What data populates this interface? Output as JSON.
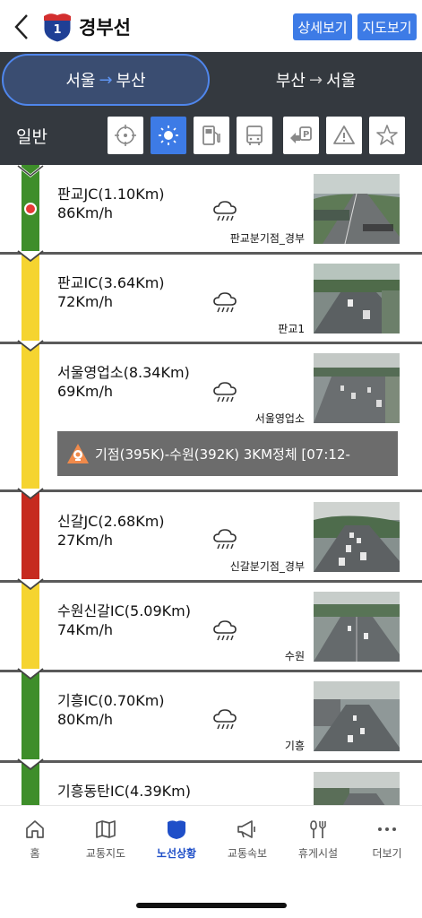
{
  "header": {
    "route_number": "1",
    "title": "경부선",
    "detail_button": "상세보기",
    "map_button": "지도보기"
  },
  "direction_tabs": [
    {
      "from": "서울",
      "arrow": "→",
      "to": "부산",
      "active": true
    },
    {
      "from": "부산",
      "arrow": "→",
      "to": "서울",
      "active": false
    }
  ],
  "filter": {
    "label": "일반",
    "buttons": [
      {
        "icon": "cctv-target-icon",
        "active": false
      },
      {
        "icon": "weather-sun-icon",
        "active": true
      },
      {
        "icon": "gas-station-icon",
        "active": false
      },
      {
        "icon": "bus-icon",
        "active": false
      },
      {
        "icon": "parking-exit-icon",
        "active": false
      },
      {
        "icon": "warning-icon",
        "active": false
      },
      {
        "icon": "favorite-star-icon",
        "active": false
      }
    ]
  },
  "colors": {
    "green": "#3e8e2a",
    "yellow": "#f5d430",
    "red": "#c62a1f",
    "accent": "#3d7be6",
    "dark_bg": "#34393f"
  },
  "segments": [
    {
      "name": "판교JC(1.10Km)",
      "speed": "86Km/h",
      "weather": "rain-cloud-icon",
      "camera_label": "판교분기점_경부",
      "status": "green",
      "incident_marker": true
    },
    {
      "name": "판교IC(3.64Km)",
      "speed": "72Km/h",
      "weather": "rain-cloud-icon",
      "camera_label": "판교1",
      "status": "yellow"
    },
    {
      "name": "서울영업소(8.34Km)",
      "speed": "69Km/h",
      "weather": "rain-cloud-icon",
      "camera_label": "서울영업소",
      "status": "yellow"
    },
    {
      "name": "신갈JC(2.68Km)",
      "speed": "27Km/h",
      "weather": "rain-cloud-icon",
      "camera_label": "신갈분기점_경부",
      "status": "red"
    },
    {
      "name": "수원신갈IC(5.09Km)",
      "speed": "74Km/h",
      "weather": "rain-cloud-icon",
      "camera_label": "수원",
      "status": "yellow"
    },
    {
      "name": "기흥IC(0.70Km)",
      "speed": "80Km/h",
      "weather": "rain-cloud-icon",
      "camera_label": "기흥",
      "status": "green"
    },
    {
      "name": "기흥동탄IC(4.39Km)",
      "speed": "",
      "weather": "",
      "camera_label": "",
      "status": "green"
    }
  ],
  "notice": {
    "text": "기점(395K)-수원(392K)  3KM정체 [07:12-",
    "icon": "road-work-icon"
  },
  "bottom_nav": [
    {
      "label": "홈",
      "icon": "home-icon",
      "active": false
    },
    {
      "label": "교통지도",
      "icon": "map-icon",
      "active": false
    },
    {
      "label": "노선상황",
      "icon": "route-shield-icon",
      "active": true
    },
    {
      "label": "교통속보",
      "icon": "megaphone-icon",
      "active": false
    },
    {
      "label": "휴게시설",
      "icon": "rest-area-icon",
      "active": false
    },
    {
      "label": "더보기",
      "icon": "more-icon",
      "active": false
    }
  ]
}
